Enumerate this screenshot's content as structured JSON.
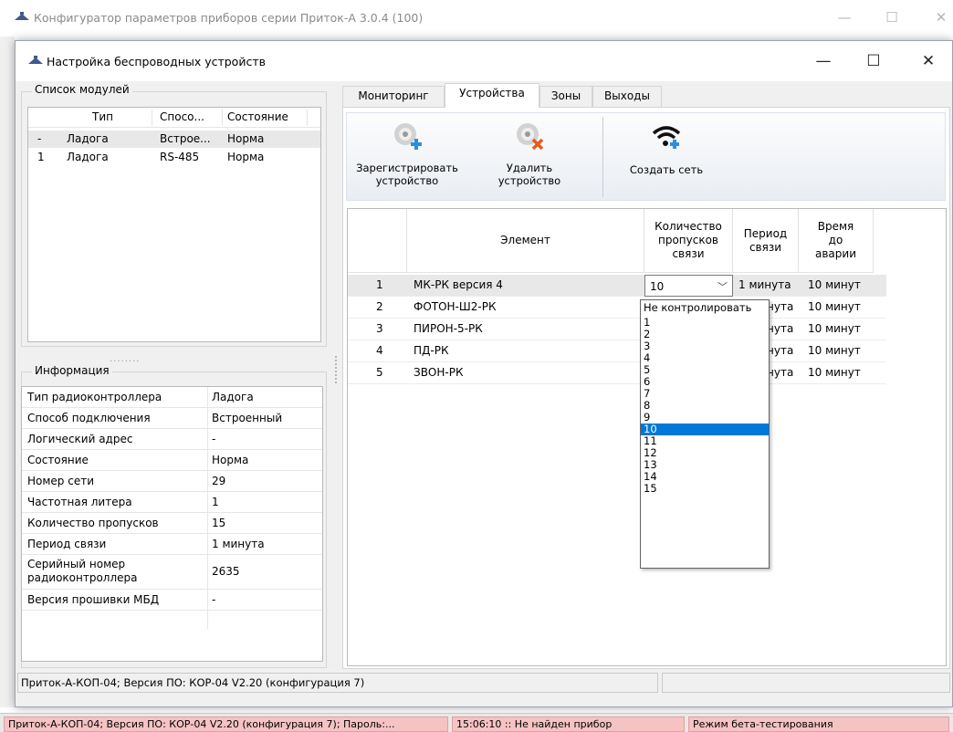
{
  "outer_window": {
    "title": "Конфигуратор параметров приборов серии Приток-А  3.0.4 (100)",
    "controls": {
      "minimize": "—",
      "maximize": "☐",
      "close": "✕"
    }
  },
  "dialog": {
    "title": "Настройка беспроводных устройств",
    "controls": {
      "minimize": "—",
      "maximize": "☐",
      "close": "✕"
    }
  },
  "modules": {
    "group_label": "Список модулей",
    "columns": [
      "Тип",
      "Спосо...",
      "Состояние"
    ],
    "rows": [
      {
        "num": "-",
        "type": "Ладога",
        "method": "Встрое...",
        "state": "Норма"
      },
      {
        "num": "1",
        "type": "Ладога",
        "method": "RS-485",
        "state": "Норма"
      }
    ]
  },
  "splitter": "........",
  "info": {
    "group_label": "Информация",
    "rows": [
      {
        "key": "Тип радиоконтроллера",
        "value": "Ладога"
      },
      {
        "key": "Способ подключения",
        "value": "Встроенный"
      },
      {
        "key": "Логический адрес",
        "value": "-"
      },
      {
        "key": "Состояние",
        "value": "Норма"
      },
      {
        "key": "Номер сети",
        "value": "29"
      },
      {
        "key": "Частотная литера",
        "value": "1"
      },
      {
        "key": "Количество пропусков",
        "value": "15"
      },
      {
        "key": "Период связи",
        "value": "1 минута"
      },
      {
        "key": "Серийный номер радиоконтроллера",
        "value": "2635"
      },
      {
        "key": "Версия прошивки МБД",
        "value": "-"
      }
    ]
  },
  "tabs": [
    "Мониторинг",
    "Устройства",
    "Зоны",
    "Выходы"
  ],
  "active_tab": "Устройства",
  "toolbar": {
    "register": "Зарегистрировать устройство",
    "delete": "Удалить устройство",
    "create_network": "Создать сеть"
  },
  "devices": {
    "columns": [
      "Элемент",
      "Количество пропусков связи",
      "Период связи",
      "Время до аварии"
    ],
    "rows": [
      {
        "num": "1",
        "element": "МК-РК версия 4",
        "skips": "10",
        "period": "1 минута",
        "alarm": "10 минут"
      },
      {
        "num": "2",
        "element": "ФОТОН-Ш2-РК",
        "skips": "",
        "period": "1 минута",
        "alarm": "10 минут"
      },
      {
        "num": "3",
        "element": "ПИРОН-5-РК",
        "skips": "",
        "period": "1 минута",
        "alarm": "10 минут"
      },
      {
        "num": "4",
        "element": "ПД-РК",
        "skips": "",
        "period": "1 минута",
        "alarm": "10 минут"
      },
      {
        "num": "5",
        "element": "ЗВОН-РК",
        "skips": "",
        "period": "1 минута",
        "alarm": "10 минут"
      }
    ],
    "visible_period_text": "нута"
  },
  "dropdown": {
    "selected": "10",
    "options": [
      "Не контролировать",
      "1",
      "2",
      "3",
      "4",
      "5",
      "6",
      "7",
      "8",
      "9",
      "10",
      "11",
      "12",
      "13",
      "14",
      "15"
    ]
  },
  "inner_status": "Приток-А-КОП-04; Версия ПО: КОР-04 V2.20 (конфигурация 7)",
  "outer_status": {
    "device": "Приток-А-КОП-04; Версия ПО: КОР-04 V2.20 (конфигурация 7); Пароль:...",
    "message": "15:06:10 :: Не найден прибор",
    "mode": "Режим бета-тестирования"
  },
  "colors": {
    "selection": "#0078d7",
    "status_pink": "#f6c3c3",
    "window_bg": "#f0f0f0"
  }
}
